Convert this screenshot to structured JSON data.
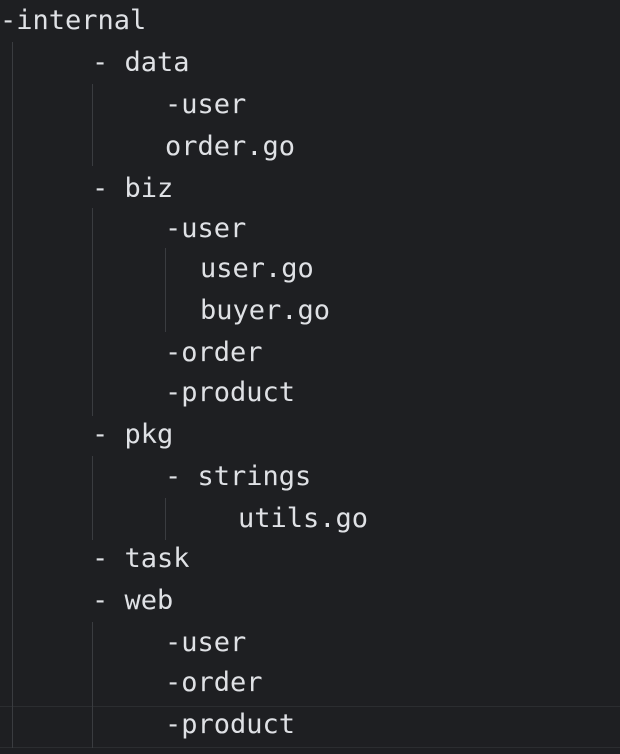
{
  "editor": {
    "lines": [
      "-internal",
      "- data",
      "-user",
      "order.go",
      "- biz",
      "-user",
      "user.go",
      "buyer.go",
      "-order",
      "-product",
      "- pkg",
      "- strings",
      "utils.go",
      "- task",
      "- web",
      "-user",
      "-order",
      "-product"
    ]
  },
  "colors": {
    "background": "#1e1f22",
    "text": "#dfe1e5",
    "indent_guide": "#3a3c40",
    "current_line_border": "#2b2d30"
  }
}
